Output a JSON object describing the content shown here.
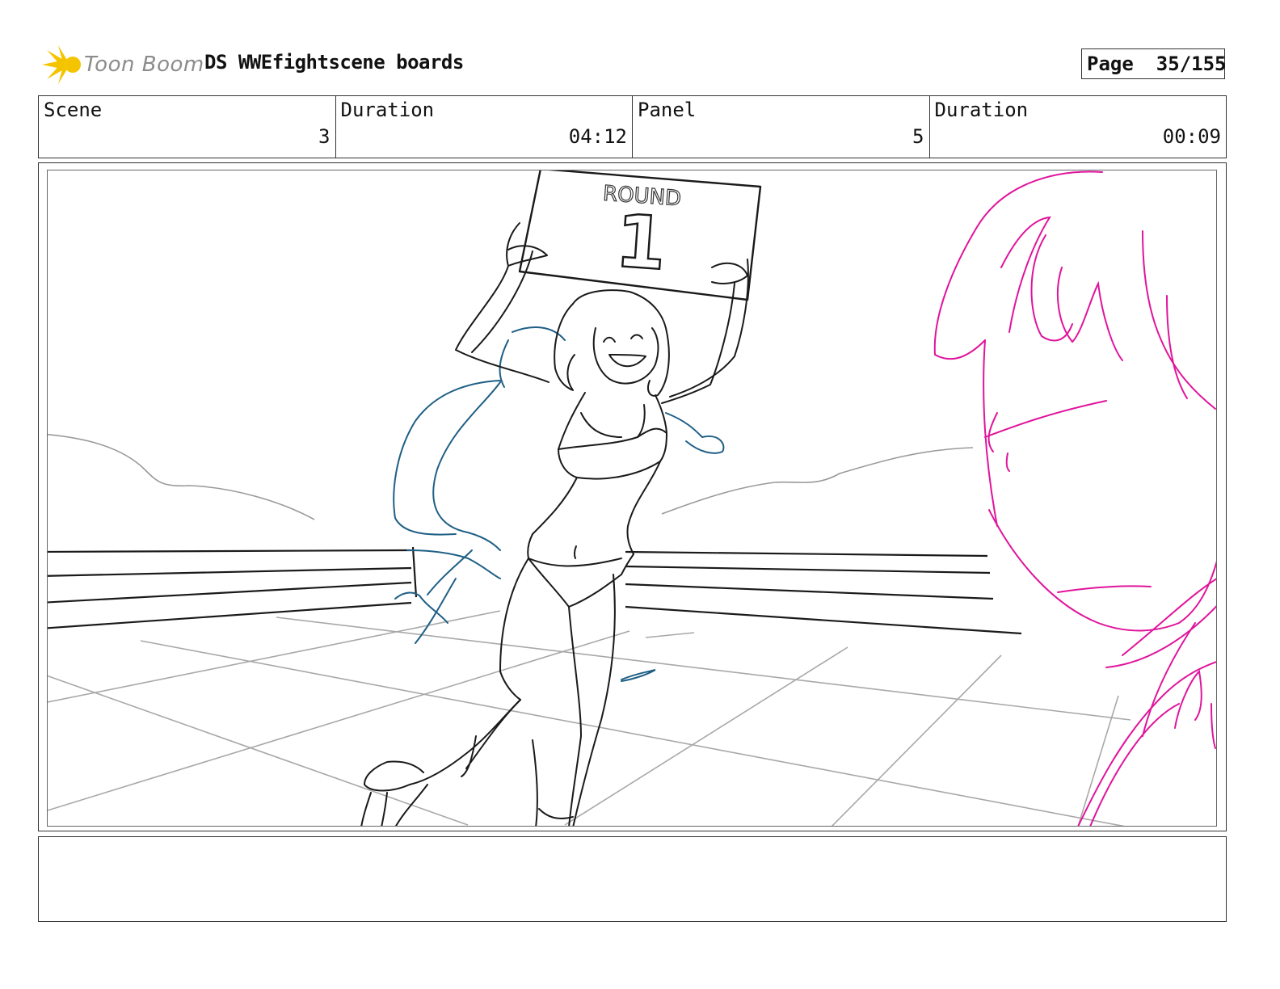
{
  "header": {
    "logo_text": "Toon Boom",
    "title": "DS WWEfightscene boards",
    "page_label": "Page",
    "page_number": "35/155"
  },
  "info": [
    {
      "label": "Scene",
      "value": "3"
    },
    {
      "label": "Duration",
      "value": "04:12"
    },
    {
      "label": "Panel",
      "value": "5"
    },
    {
      "label": "Duration",
      "value": "00:09"
    }
  ],
  "panel": {
    "sign_text": "ROUND",
    "sign_number": "1"
  },
  "colors": {
    "sketch_black": "#1a1a1a",
    "sketch_gray": "#9a9a9a",
    "sketch_blue": "#1f5f86",
    "sketch_magenta": "#e0149c",
    "logo_yellow": "#f5c400"
  }
}
